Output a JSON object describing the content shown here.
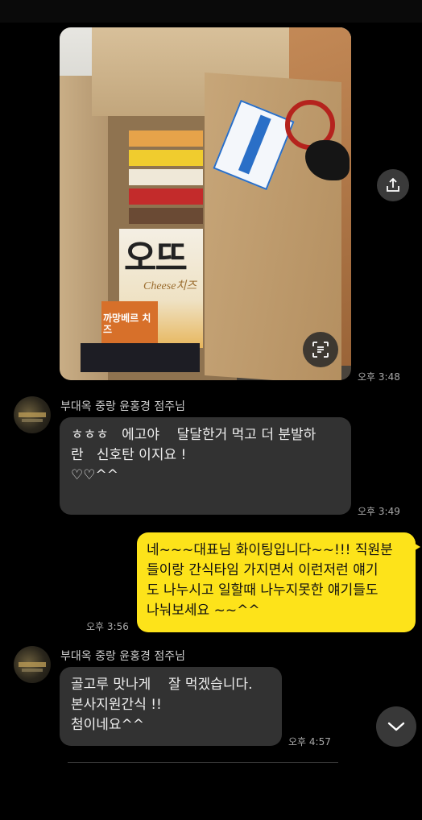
{
  "photo_message": {
    "time": "오후 3:48",
    "product_text": "오뜨",
    "product_sub": "Cheese치즈",
    "product_text_2": "까망베르 치즈"
  },
  "messages": [
    {
      "sender": "부대옥 중랑 윤홍경 점주님",
      "lines": [
        "ㅎㅎㅎ   에고야    달달한거 먹고 더 분발하",
        "란   신호탄 이지요 !",
        "♡♡^^"
      ],
      "time": "오후 3:49"
    },
    {
      "lines": [
        "네~~~대표님 화이팅입니다~~!!! 직원분",
        "들이랑 간식타임 가지면서 이런저런 얘기",
        "도 나누시고 일할때 나누지못한 얘기들도",
        "나눠보세요 ~~^^"
      ],
      "time": "오후 3:56"
    },
    {
      "sender": "부대옥 중랑 윤홍경 점주님",
      "lines": [
        "골고루 맛나게    잘 먹겠습니다.",
        "본사지원간식 !!",
        "첨이네요^^"
      ],
      "time": "오후 4:57"
    }
  ],
  "icons": {
    "share": "share-icon",
    "scan": "text-scan-icon",
    "scroll": "chevron-down-icon"
  }
}
